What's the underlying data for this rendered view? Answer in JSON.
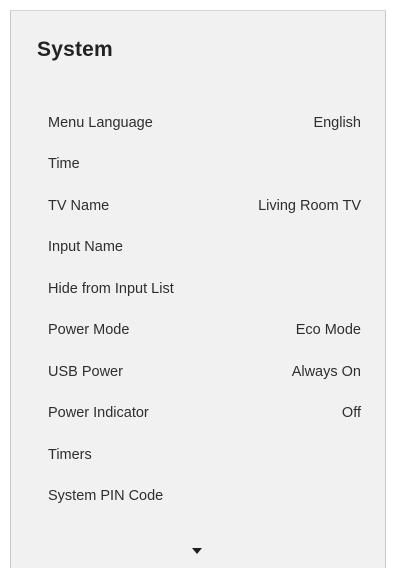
{
  "panel": {
    "title": "System",
    "items": [
      {
        "label": "Menu Language",
        "value": "English"
      },
      {
        "label": "Time",
        "value": ""
      },
      {
        "label": "TV Name",
        "value": "Living Room TV"
      },
      {
        "label": "Input Name",
        "value": ""
      },
      {
        "label": "Hide from Input List",
        "value": ""
      },
      {
        "label": "Power Mode",
        "value": "Eco Mode"
      },
      {
        "label": "USB Power",
        "value": "Always On"
      },
      {
        "label": "Power Indicator",
        "value": "Off"
      },
      {
        "label": "Timers",
        "value": ""
      },
      {
        "label": "System PIN Code",
        "value": ""
      }
    ],
    "scroll_indicator_icon": "chevron-down-icon"
  }
}
